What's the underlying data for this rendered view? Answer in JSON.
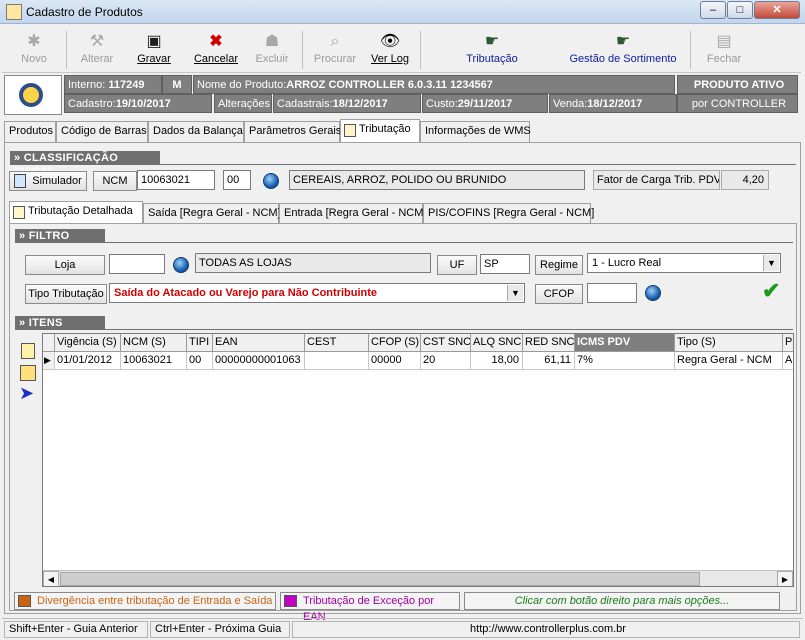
{
  "window": {
    "title": "Cadastro de Produtos",
    "min": "–",
    "max": "□",
    "close": "✕"
  },
  "toolbar": [
    {
      "label": "Novo",
      "icon": "bug-icon",
      "enabled": false
    },
    {
      "label": "Alterar",
      "icon": "hammer-icon",
      "enabled": false
    },
    {
      "label": "Gravar",
      "icon": "floppy-disk-icon",
      "enabled": true
    },
    {
      "label": "Cancelar",
      "icon": "red-x-icon",
      "enabled": true
    },
    {
      "label": "Excluir",
      "icon": "robot-icon",
      "enabled": false
    },
    {
      "label": "Procurar",
      "icon": "magnifier-icon",
      "enabled": false
    },
    {
      "label": "Ver Log",
      "icon": "eye-icon",
      "enabled": true
    },
    {
      "label": "Tributação",
      "icon": "hand-icon",
      "enabled": true
    },
    {
      "label": "Gestão de Sortimento",
      "icon": "hand-point-icon",
      "enabled": true
    },
    {
      "label": "Fechar",
      "icon": "exit-door-icon",
      "enabled": false
    }
  ],
  "product": {
    "interno_label": "Interno:",
    "interno": "117249",
    "m": "M",
    "nome_label": "Nome do Produto:",
    "nome": "ARROZ  CONTROLLER 6.0.3.11 1234567",
    "status": "PRODUTO ATIVO",
    "cadastro_label": "Cadastro:",
    "cadastro": "19/10/2017",
    "alteracoes_label": "Alterações",
    "cadastrais_label": "Cadastrais:",
    "cadastrais": "18/12/2017",
    "custo_label": "Custo:",
    "custo": "29/11/2017",
    "venda_label": "Venda:",
    "venda": "18/12/2017",
    "por_label": "por",
    "por": "CONTROLLER"
  },
  "tabs": [
    "Produtos",
    "Código de Barras",
    "Dados da Balança",
    "Parâmetros Gerais",
    "Tributação",
    "Informações de WMS"
  ],
  "classificacao": {
    "title": "» CLASSIFICAÇÃO FISCAL",
    "simulador": "Simulador",
    "ncm_label": "NCM",
    "ncm": "10063021",
    "ex": "00",
    "ncm_desc": "CEREAIS, ARROZ, POLIDO OU BRUNIDO",
    "fator_label": "Fator de Carga Trib. PDV",
    "fator": "4,20"
  },
  "subtabs": [
    "Tributação Detalhada",
    "Saída [Regra Geral - NCM]",
    "Entrada [Regra Geral - NCM]",
    "PIS/COFINS [Regra Geral - NCM]"
  ],
  "filtro": {
    "title": "» FILTRO",
    "loja_label": "Loja",
    "loja": "",
    "loja_desc": "TODAS AS LOJAS",
    "uf_label": "UF",
    "uf": "SP",
    "regime_label": "Regime",
    "regime": "1 - Lucro Real",
    "tipo_label": "Tipo Tributação",
    "tipo": "Saída do Atacado ou Varejo para Não Contribuinte",
    "cfop_label": "CFOP",
    "cfop": ""
  },
  "itens": {
    "title": "» ITENS",
    "columns": [
      "Vigência (S)",
      "NCM (S)",
      "TIPI",
      "EAN",
      "CEST",
      "CFOP (S)",
      "CST SNC",
      "ALQ SNC",
      "RED SNC",
      "ICMS PDV",
      "Tipo (S)",
      "P"
    ],
    "rows": [
      [
        "01/01/2012",
        "10063021",
        "00",
        "00000000001063",
        "",
        "00000",
        "20",
        "18,00",
        "61,11",
        "7%",
        "Regra Geral - NCM",
        "Al"
      ]
    ]
  },
  "legend": {
    "divergencia": "Divergência entre tributação de Entrada e Saída",
    "excecao": "Tributação de Exceção por EAN",
    "hint": "Clicar com botão direito para mais opções..."
  },
  "status": {
    "left": "Shift+Enter - Guia Anterior",
    "mid": "Ctrl+Enter - Próxima Guia",
    "url": "http://www.controllerplus.com.br"
  },
  "colors": {
    "orange": "#c86414",
    "magenta": "#c400c4",
    "grey_header": "#6f6f6f",
    "hint_green": "#1a7a1a",
    "tipo_red": "#d00000"
  }
}
